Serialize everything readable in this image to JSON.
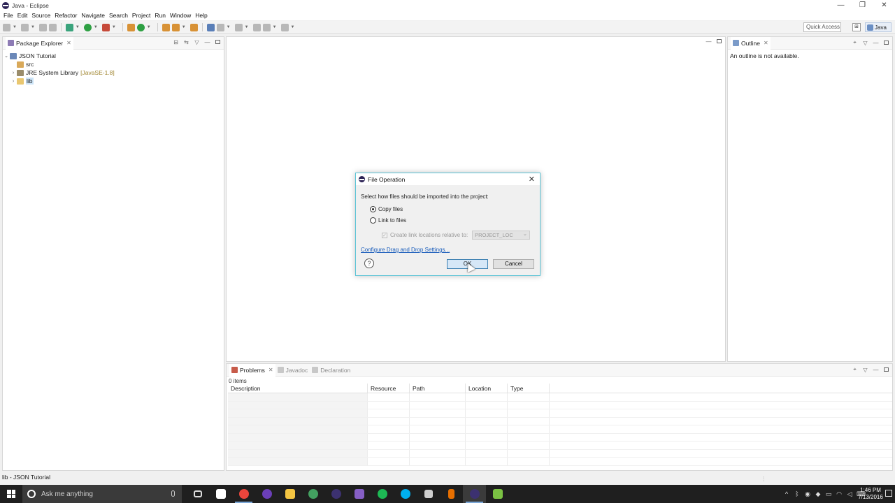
{
  "window": {
    "title": "Java - Eclipse",
    "controls": [
      "—",
      "❐",
      "✕"
    ]
  },
  "menu": [
    "File",
    "Edit",
    "Source",
    "Refactor",
    "Navigate",
    "Search",
    "Project",
    "Run",
    "Window",
    "Help"
  ],
  "toolbar": {
    "quick_access": "Quick Access",
    "perspective": "Java"
  },
  "package_explorer": {
    "tab": "Package Explorer",
    "tree": [
      {
        "label": "JSON Tutorial",
        "expanded": true
      },
      {
        "label": "src"
      },
      {
        "label": "JRE System Library",
        "decoration": "[JavaSE-1.8]"
      },
      {
        "label": "lib",
        "selected": true
      }
    ]
  },
  "outline": {
    "tab": "Outline",
    "message": "An outline is not available."
  },
  "bottom_panel": {
    "tabs": [
      "Problems",
      "Javadoc",
      "Declaration"
    ],
    "items_count": "0 items",
    "columns": [
      "Description",
      "Resource",
      "Path",
      "Location",
      "Type"
    ]
  },
  "status_bar": {
    "text": "lib - JSON Tutorial"
  },
  "dialog": {
    "title": "File Operation",
    "prompt": "Select how files should be imported into the project:",
    "option_copy": "Copy files",
    "option_link": "Link to files",
    "link_relative_label": "Create link locations relative to:",
    "link_relative_value": "PROJECT_LOC",
    "settings_link": "Configure Drag and Drop Settings...",
    "help": "?",
    "ok": "OK",
    "cancel": "Cancel"
  },
  "taskbar": {
    "search_placeholder": "Ask me anything",
    "time": "1:46 PM",
    "date": "7/13/2016"
  },
  "colors": {
    "dialog_border": "#5bc4d6",
    "link": "#1a5dbb",
    "taskbar": "#1f1f1f"
  }
}
